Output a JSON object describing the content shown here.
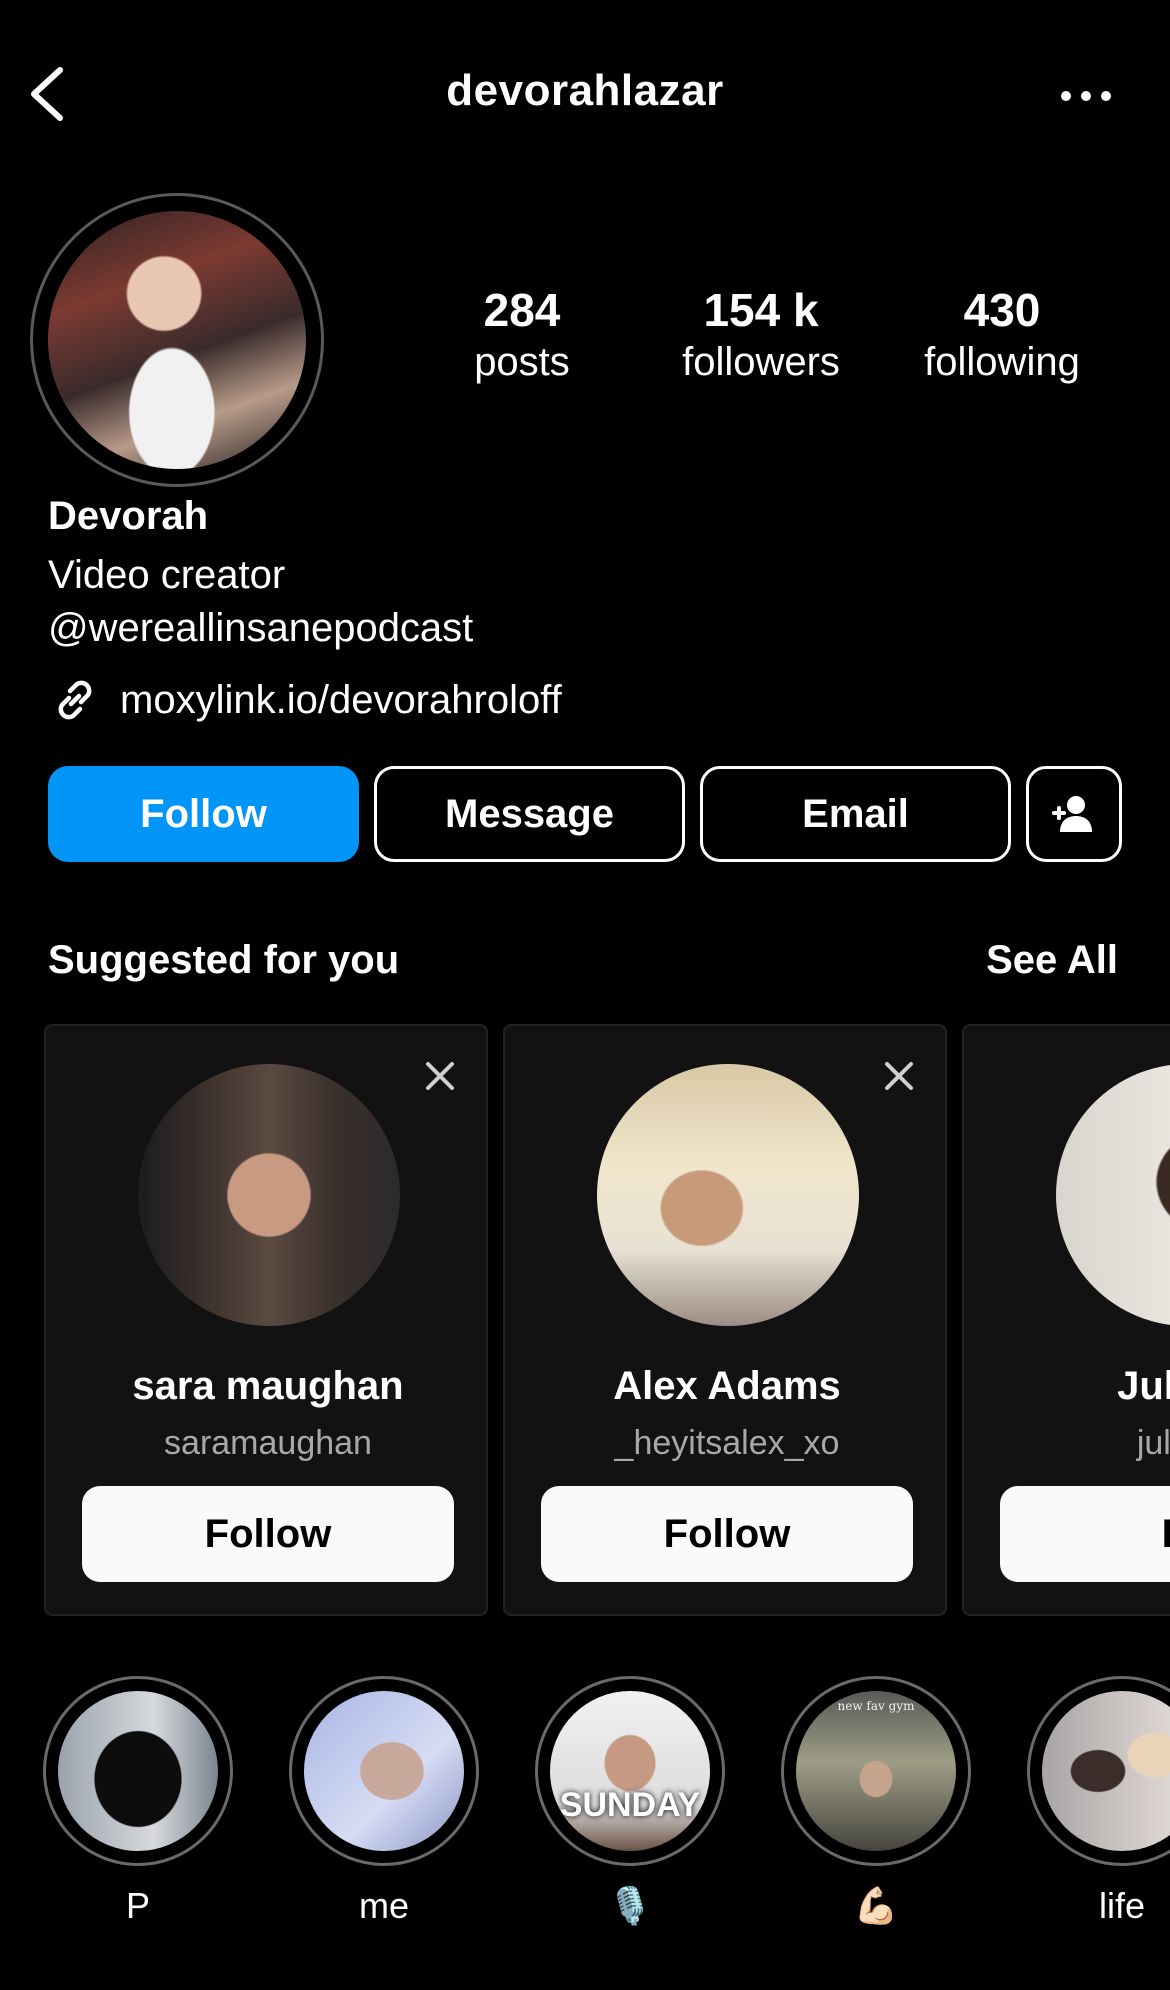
{
  "header": {
    "username": "devorahlazar"
  },
  "stats": {
    "posts_count": "284",
    "posts_label": "posts",
    "followers_count": "154 k",
    "followers_label": "followers",
    "following_count": "430",
    "following_label": "following"
  },
  "bio": {
    "name": "Devorah",
    "line1": "Video creator",
    "line2": "@wereallinsanepodcast",
    "link": "moxylink.io/devorahroloff"
  },
  "actions": {
    "follow": "Follow",
    "message": "Message",
    "email": "Email"
  },
  "suggested": {
    "title": "Suggested for you",
    "see_all": "See All",
    "cards": [
      {
        "name": "sara maughan",
        "username": "saramaughan",
        "follow": "Follow"
      },
      {
        "name": "Alex Adams",
        "username": "_heyitsalex_xo",
        "follow": "Follow"
      },
      {
        "name": "Juliana",
        "username": "juliana",
        "follow": "Fo"
      }
    ]
  },
  "highlights": [
    {
      "label": "P"
    },
    {
      "label": "me"
    },
    {
      "label": "🎙️",
      "overlay": "SUNDAY"
    },
    {
      "label": "💪🏻",
      "overlay": "new fav gym"
    },
    {
      "label": "life"
    }
  ],
  "colors": {
    "follow_blue": "#0095f6",
    "background": "#000000",
    "card_bg": "#121212"
  }
}
